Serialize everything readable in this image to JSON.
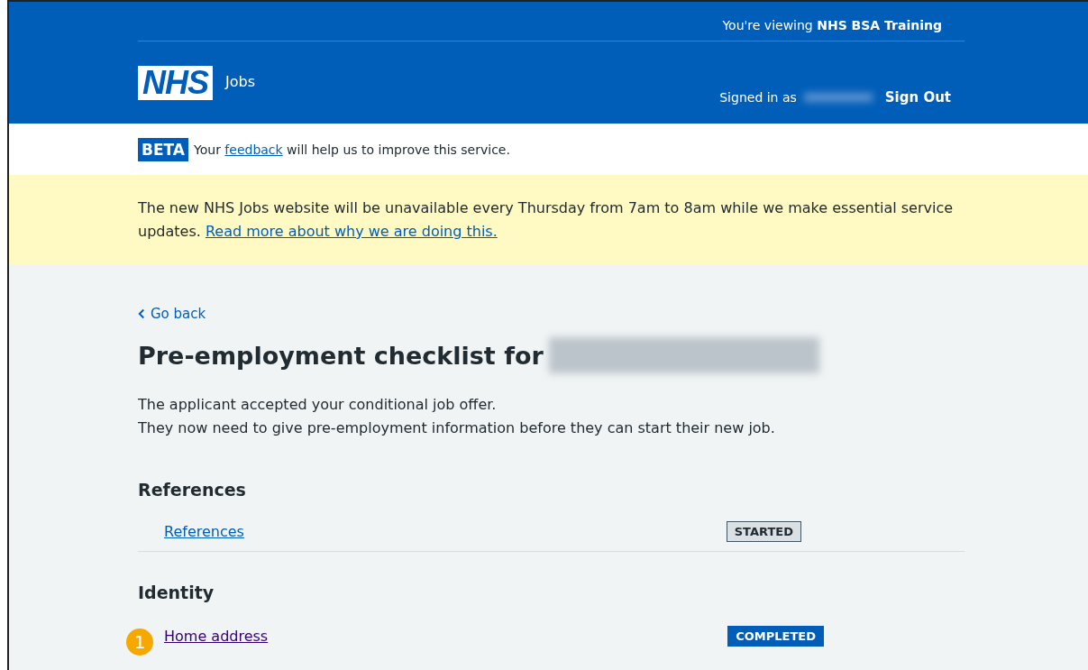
{
  "header": {
    "viewing_prefix": "You're viewing",
    "organisation": "NHS BSA Training",
    "logo": "NHS",
    "service": "Jobs",
    "signed_in_label": "Signed in as",
    "sign_out": "Sign Out"
  },
  "beta": {
    "tag": "BETA",
    "before": "Your",
    "link": "feedback",
    "after": "will help us to improve this service."
  },
  "banner": {
    "text": "The new NHS Jobs website will be unavailable every Thursday from 7am to 8am while we make essential service updates.",
    "link": "Read more about why we are doing this."
  },
  "back_link": "Go back",
  "title": "Pre-employment checklist for",
  "intro": [
    "The applicant accepted your conditional job offer.",
    "They now need to give pre-employment information before they can start their new job."
  ],
  "sections": [
    {
      "heading": "References",
      "items": [
        {
          "label": "References",
          "visited": false,
          "status": "STARTED",
          "kind": "started"
        }
      ]
    },
    {
      "heading": "Identity",
      "items": [
        {
          "label": "Home address",
          "visited": true,
          "status": "COMPLETED",
          "kind": "completed",
          "callout": "1"
        }
      ]
    }
  ]
}
